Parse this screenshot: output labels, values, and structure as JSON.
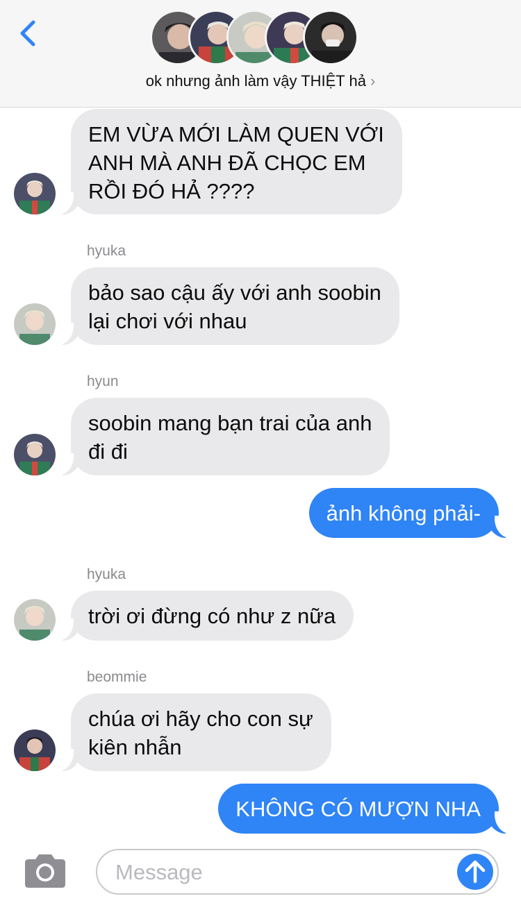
{
  "header": {
    "back_icon": "chevron-left-icon",
    "group_name": "ok nhưng ảnh làm vậy THIỆT hả",
    "group_chevron": "›",
    "avatars": [
      "member-photo-1",
      "member-photo-2",
      "member-photo-3",
      "member-photo-4",
      "member-photo-5"
    ]
  },
  "messages": [
    {
      "direction": "incoming",
      "sender": "",
      "text": "EM VỪA MỚI LÀM QUEN VỚI\nANH MÀ ANH ĐÃ CHỌC EM\nRỒI ĐÓ HẢ ????"
    },
    {
      "direction": "incoming",
      "sender": "hyuka",
      "text": "bảo sao cậu ấy với anh soobin\nlại chơi với nhau"
    },
    {
      "direction": "incoming",
      "sender": "hyun",
      "text": "soobin mang bạn trai của anh\nđi đi"
    },
    {
      "direction": "outgoing",
      "sender": "",
      "text": "ảnh không phải-"
    },
    {
      "direction": "incoming",
      "sender": "hyuka",
      "text": "trời ơi đừng có như z nữa"
    },
    {
      "direction": "incoming",
      "sender": "beommie",
      "text": "chúa ơi hãy cho con sự\nkiên nhẫn"
    },
    {
      "direction": "outgoing",
      "sender": "",
      "text": "KHÔNG CÓ MƯỢN NHA"
    }
  ],
  "composer": {
    "camera_icon": "camera-icon",
    "placeholder": "Message",
    "value": "",
    "send_icon": "arrow-up-icon"
  },
  "colors": {
    "accent": "#2f84f6",
    "incoming_bubble": "#e9e9eb",
    "header_bg": "#f6f6f6"
  }
}
